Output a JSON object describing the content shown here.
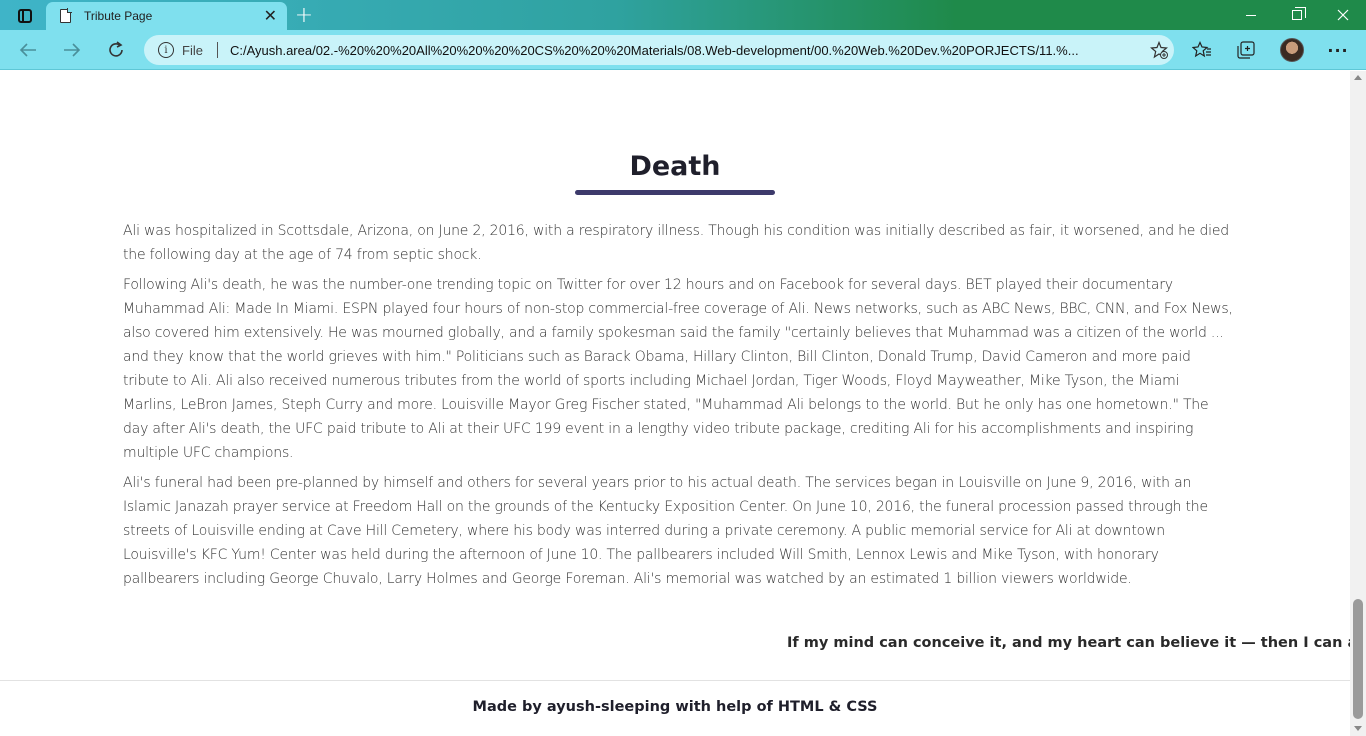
{
  "browser": {
    "tab": {
      "title": "Tribute Page",
      "close_glyph": "✕"
    },
    "new_tab_glyph": "+",
    "omnibox": {
      "scheme_label": "File",
      "url": "C:/Ayush.area/02.-%20%20%20All%20%20%20%20CS%20%20%20Materials/08.Web-development/00.%20Web.%20Dev.%20PORJECTS/11.%..."
    },
    "icons": {
      "back": "arrow-left-icon",
      "forward": "arrow-right-icon",
      "reload": "reload-icon",
      "info": "info-icon",
      "add_favorite": "star-plus-icon",
      "favorites": "favorites-icon",
      "collections": "collections-icon",
      "profile": "avatar",
      "more": "more-icon"
    }
  },
  "page": {
    "section_title": "Death",
    "paragraphs": [
      "Ali was hospitalized in Scottsdale, Arizona, on June 2, 2016, with a respiratory illness. Though his condition was initially described as fair, it worsened, and he died the following day at the age of 74 from septic shock.",
      "Following Ali's death, he was the number-one trending topic on Twitter for over 12 hours and on Facebook for several days. BET played their documentary Muhammad Ali: Made In Miami. ESPN played four hours of non-stop commercial-free coverage of Ali. News networks, such as ABC News, BBC, CNN, and Fox News, also covered him extensively. He was mourned globally, and a family spokesman said the family \"certainly believes that Muhammad was a citizen of the world ... and they know that the world grieves with him.\" Politicians such as Barack Obama, Hillary Clinton, Bill Clinton, Donald Trump, David Cameron and more paid tribute to Ali. Ali also received numerous tributes from the world of sports including Michael Jordan, Tiger Woods, Floyd Mayweather, Mike Tyson, the Miami Marlins, LeBron James, Steph Curry and more. Louisville Mayor Greg Fischer stated, \"Muhammad Ali belongs to the world. But he only has one hometown.\" The day after Ali's death, the UFC paid tribute to Ali at their UFC 199 event in a lengthy video tribute package, crediting Ali for his accomplishments and inspiring multiple UFC champions.",
      "Ali's funeral had been pre-planned by himself and others for several years prior to his actual death. The services began in Louisville on June 9, 2016, with an Islamic Janazah prayer service at Freedom Hall on the grounds of the Kentucky Exposition Center. On June 10, 2016, the funeral procession passed through the streets of Louisville ending at Cave Hill Cemetery, where his body was interred during a private ceremony. A public memorial service for Ali at downtown Louisville's KFC Yum! Center was held during the afternoon of June 10. The pallbearers included Will Smith, Lennox Lewis and Mike Tyson, with honorary pallbearers including George Chuvalo, Larry Holmes and George Foreman. Ali's memorial was watched by an estimated 1 billion viewers worldwide."
    ],
    "quote": "If my mind can conceive it, and my heart can believe it — then I can achieve it.",
    "footer": "Made by ayush-sleeping with help of HTML & CSS"
  },
  "colors": {
    "tab_active": "#7fe0ee",
    "heading_underline": "#3d3a6b",
    "text": "#333333"
  }
}
